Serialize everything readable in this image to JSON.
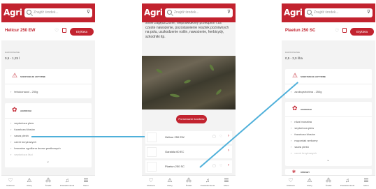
{
  "app": {
    "logo": "Agri",
    "search_placeholder": "Znajdź środek...",
    "filter_icon": "filter-icon",
    "accent": "#c2232f",
    "connector_color": "#4fb0da"
  },
  "nav": [
    {
      "label": "Ulubione",
      "icon": "heart-icon",
      "glyph": "♡"
    },
    {
      "label": "Alerty",
      "icon": "warning-icon",
      "glyph": "⚠"
    },
    {
      "label": "Środki",
      "icon": "products-icon",
      "glyph": "⁂"
    },
    {
      "label": "Powiadomienia",
      "icon": "bell-icon",
      "glyph": "🔔"
    },
    {
      "label": "Menu",
      "icon": "menu-icon",
      "glyph": "☰"
    }
  ],
  "screen1": {
    "product": "Helicur 250 EW",
    "cta": "Etykieta",
    "dose_label": "dawkowanie",
    "dose_value": "0,5 - 1,25 l",
    "substances_title": "substancje aktywne",
    "substances": [
      "tebukonazol - 250g"
    ],
    "diseases_title": "agrofagi",
    "diseases": [
      "septorioza plew",
      "fuzarioza kłosów",
      "szara pleśń",
      "czerń krzyżowych",
      "brunatne zgnilizna drzew pestkowych",
      "septorioza liści"
    ]
  },
  "screen2": {
    "description": "silnie zagęszczone, nieprawidłowy przedplon i za częste nawożenie, pozostawienie resztek pożniwnych na polu, uszkodzenie roślin, nawożenie, herbicydy, szkodniki itp.",
    "cta": "Porównanie środków",
    "list": [
      "Helicur 250 EW",
      "Garaidia 60 EC",
      "Plaetun 250 SC"
    ]
  },
  "screen3": {
    "product": "Plaetun 250 SC",
    "cta": "Etykieta",
    "dose_label": "dawkowanie",
    "dose_value": "0,5 - 3,0 l/ha",
    "substances_title": "substancje aktywne",
    "substances": [
      "azoksystrobina - 250g"
    ],
    "diseases_title": "agrofagi",
    "diseases": [
      "rdza brunatna",
      "septorioza plew",
      "fuzarioza kłosów",
      "mączniak rzekomy",
      "szara pleśń",
      "czerń krzyżowych"
    ],
    "next_title": "uprawy"
  }
}
